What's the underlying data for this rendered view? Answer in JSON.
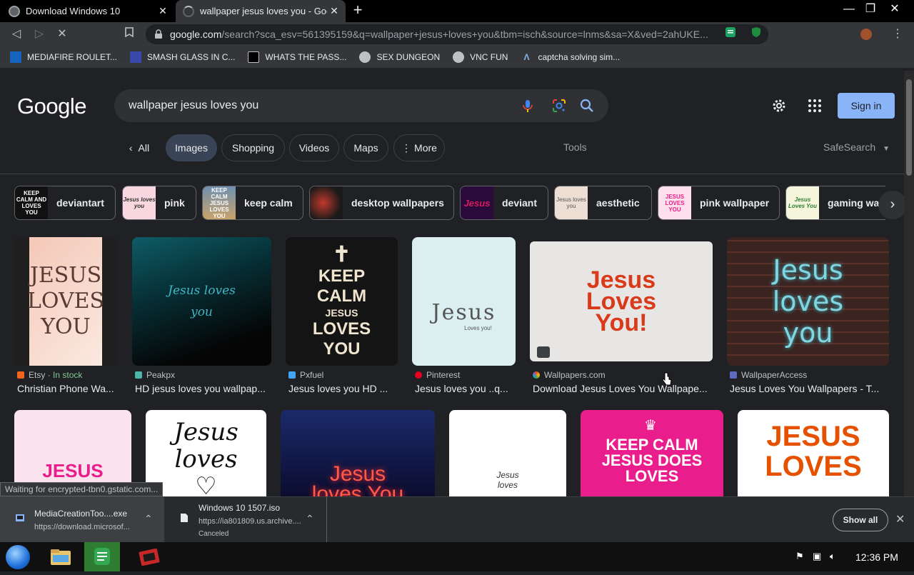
{
  "browser": {
    "tabs": [
      {
        "title": "Download Windows 10",
        "active": false
      },
      {
        "title": "wallpaper jesus loves you - Google Search",
        "active": true
      }
    ],
    "address": {
      "host": "google.com",
      "rest": "/search?sca_esv=561395159&q=wallpaper+jesus+loves+you&tbm=isch&source=lnms&sa=X&ved=2ahUKE..."
    },
    "bookmarks": [
      "MEDIAFIRE ROULET...",
      "SMASH GLASS IN C...",
      "WHATS THE PASS...",
      "SEX DUNGEON",
      "VNC FUN",
      "captcha solving sim..."
    ],
    "status_text": "Waiting for encrypted-tbn0.gstatic.com..."
  },
  "google": {
    "logo": "Google",
    "query": "wallpaper jesus loves you",
    "sign_in": "Sign in",
    "nav": {
      "all": "All",
      "images": "Images",
      "shopping": "Shopping",
      "videos": "Videos",
      "maps": "Maps",
      "more": "More",
      "tools": "Tools",
      "safesearch": "SafeSearch"
    },
    "chips": [
      {
        "label": "deviantart",
        "thumb": "KEEP CALM AND LOVES YOU"
      },
      {
        "label": "pink",
        "thumb": "Jesus loves you"
      },
      {
        "label": "keep calm",
        "thumb": "KEEP CALM JESUS LOVES YOU"
      },
      {
        "label": "desktop wallpapers",
        "thumb": ""
      },
      {
        "label": "deviant",
        "thumb": "Jesus"
      },
      {
        "label": "aesthetic",
        "thumb": "Jesus loves you"
      },
      {
        "label": "pink wallpaper",
        "thumb": "JESUS LOVES YOU"
      },
      {
        "label": "gaming wa",
        "thumb": "Jesus Loves You"
      }
    ],
    "results_row1": [
      {
        "source": "Etsy",
        "stock": "In stock",
        "caption": "Christian Phone Wa...",
        "art": "JESUS LOVES YOU"
      },
      {
        "source": "Peakpx",
        "caption": "HD jesus loves you wallpap...",
        "art": "Jesus loves you"
      },
      {
        "source": "Pxfuel",
        "caption": "Jesus loves you HD ...",
        "art_lines": [
          "✝",
          "KEEP",
          "CALM",
          "JESUS",
          "LOVES",
          "YOU"
        ]
      },
      {
        "source": "Pinterest",
        "caption": "Jesus loves you ..q...",
        "art": "Jesus",
        "art_sub": "Loves you!"
      },
      {
        "source": "Wallpapers.com",
        "caption": "Download Jesus Loves You Wallpape...",
        "art": "Jesus Loves You!"
      },
      {
        "source": "WallpaperAccess",
        "caption": "Jesus Loves You Wallpapers - T...",
        "art": "Jesus loves you"
      }
    ],
    "results_row2": [
      {
        "art": "JESUS"
      },
      {
        "art": "Jesus loves ♡"
      },
      {
        "art": "Jesus loves You"
      },
      {
        "art": "Jesus loves"
      },
      {
        "art": "KEEP CALM JESUS DOES LOVES"
      },
      {
        "art": "JESUS LOVES"
      }
    ]
  },
  "downloads": [
    {
      "name": "MediaCreationToo....exe",
      "url": "https://download.microsof..."
    },
    {
      "name": "Windows 10 1507.iso",
      "url": "https://ia801809.us.archive....",
      "status": "Canceled"
    }
  ],
  "show_all": "Show all",
  "taskbar": {
    "time": "12:36 PM"
  },
  "colors": {
    "signin_bg": "#8ab4f8",
    "page_bg": "#202124",
    "accent_pink": "#e91e8c"
  }
}
